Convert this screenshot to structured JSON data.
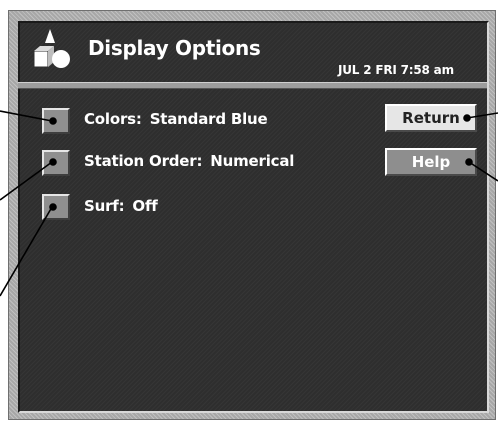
{
  "header": {
    "title": "Display Options",
    "datetime": "JUL 2 FRI 7:58 am"
  },
  "options": [
    {
      "label": "Colors:",
      "value": "Standard Blue"
    },
    {
      "label": "Station Order:",
      "value": "Numerical"
    },
    {
      "label": "Surf:",
      "value": "Off"
    }
  ],
  "buttons": {
    "return_label": "Return",
    "help_label": "Help"
  },
  "icons": {
    "logo": "shapes-logo-icon"
  }
}
